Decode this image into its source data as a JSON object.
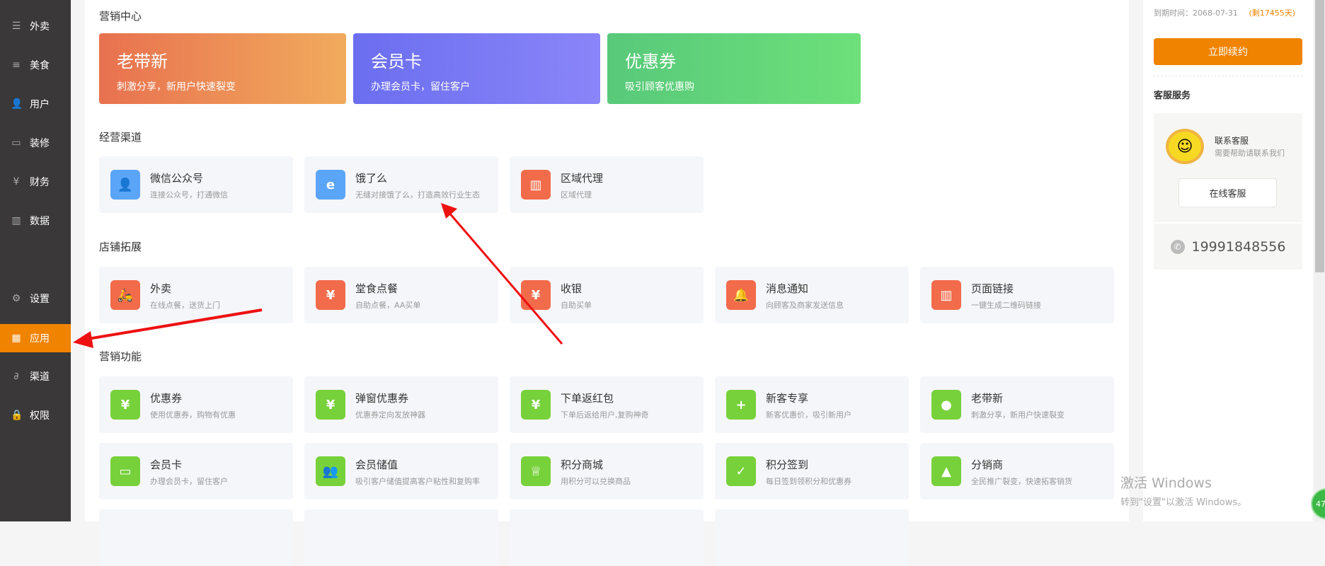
{
  "sidebar": {
    "items": [
      {
        "label": "外卖",
        "icon": "document-icon",
        "glyph": "☰"
      },
      {
        "label": "美食",
        "icon": "list-icon",
        "glyph": "≡"
      },
      {
        "label": "用户",
        "icon": "user-icon",
        "glyph": "👤"
      },
      {
        "label": "装修",
        "icon": "brush-icon",
        "glyph": "▭"
      },
      {
        "label": "财务",
        "icon": "wallet-icon",
        "glyph": "¥"
      },
      {
        "label": "数据",
        "icon": "bar-chart-icon",
        "glyph": "▥"
      },
      {
        "label": "设置",
        "icon": "gear-icon",
        "glyph": "⚙"
      },
      {
        "label": "应用",
        "icon": "apps-icon",
        "glyph": "▦",
        "active": true
      },
      {
        "label": "渠道",
        "icon": "link-icon",
        "glyph": "∂"
      },
      {
        "label": "权限",
        "icon": "lock-icon",
        "glyph": "🔒"
      }
    ]
  },
  "sections": {
    "marketing_center": "营销中心",
    "channels": "经营渠道",
    "store_expansion": "店铺拓展",
    "marketing_features": "营销功能"
  },
  "banners": [
    {
      "title": "老带新",
      "desc": "刺激分享，新用户快速裂变"
    },
    {
      "title": "会员卡",
      "desc": "办理会员卡，留住客户"
    },
    {
      "title": "优惠券",
      "desc": "吸引顾客优惠购"
    }
  ],
  "channels": [
    {
      "title": "微信公众号",
      "desc": "连接公众号，打通微信",
      "color": "#5aa5f8",
      "glyph": "👤"
    },
    {
      "title": "饿了么",
      "desc": "无缝对接饿了么，打造高效行业生态",
      "color": "#5aa5f8",
      "glyph": "e"
    },
    {
      "title": "区域代理",
      "desc": "区域代理",
      "color": "#f26b4a",
      "glyph": "▥"
    }
  ],
  "store": [
    {
      "title": "外卖",
      "desc": "在线点餐，送货上门",
      "color": "#f26b4a",
      "glyph": "🛵"
    },
    {
      "title": "堂食点餐",
      "desc": "自助点餐，AA买单",
      "color": "#f26b4a",
      "glyph": "¥"
    },
    {
      "title": "收银",
      "desc": "自助买单",
      "color": "#f26b4a",
      "glyph": "¥"
    },
    {
      "title": "消息通知",
      "desc": "向顾客及商家发送信息",
      "color": "#f26b4a",
      "glyph": "🔔"
    },
    {
      "title": "页面链接",
      "desc": "一键生成二维码链接",
      "color": "#f26b4a",
      "glyph": "▥"
    }
  ],
  "marketing": [
    {
      "title": "优惠券",
      "desc": "使用优惠券，购物有优惠",
      "color": "#77d13a",
      "glyph": "¥"
    },
    {
      "title": "弹窗优惠券",
      "desc": "优惠券定向发放神器",
      "color": "#77d13a",
      "glyph": "¥"
    },
    {
      "title": "下单返红包",
      "desc": "下单后返给用户,复购神奇",
      "color": "#77d13a",
      "glyph": "¥"
    },
    {
      "title": "新客专享",
      "desc": "新客优惠价，吸引新用户",
      "color": "#77d13a",
      "glyph": "+"
    },
    {
      "title": "老带新",
      "desc": "刺激分享，新用户快速裂变",
      "color": "#77d13a",
      "glyph": "●"
    },
    {
      "title": "会员卡",
      "desc": "办理会员卡，留住客户",
      "color": "#77d13a",
      "glyph": "▭"
    },
    {
      "title": "会员储值",
      "desc": "吸引客户储值提高客户粘性和复购率",
      "color": "#77d13a",
      "glyph": "👥"
    },
    {
      "title": "积分商城",
      "desc": "用积分可以兑换商品",
      "color": "#77d13a",
      "glyph": "♕"
    },
    {
      "title": "积分签到",
      "desc": "每日签到领积分和优惠券",
      "color": "#77d13a",
      "glyph": "✓"
    },
    {
      "title": "分销商",
      "desc": "全民推广裂变，快速拓客销货",
      "color": "#77d13a",
      "glyph": "▲"
    }
  ],
  "right": {
    "expire_label": "到期时间：2068-07-31",
    "remaining": "(剩17455天)",
    "renew_button": "立即续约",
    "service_title": "客服服务",
    "contact_title": "联系客服",
    "contact_desc": "需要帮助请联系我们",
    "online_button": "在线客服",
    "phone": "19991848556"
  },
  "watermark": {
    "line1": "激活 Windows",
    "line2": "转到\"设置\"以激活 Windows。"
  },
  "badge": "47"
}
